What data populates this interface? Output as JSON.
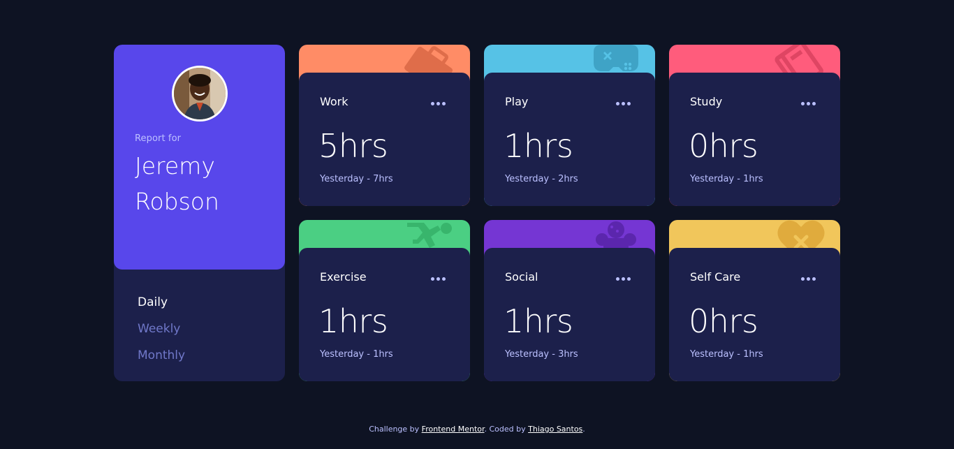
{
  "profile": {
    "report_for": "Report for",
    "first_name": "Jeremy",
    "last_name": "Robson"
  },
  "periods": [
    {
      "label": "Daily",
      "active": true
    },
    {
      "label": "Weekly",
      "active": false
    },
    {
      "label": "Monthly",
      "active": false
    }
  ],
  "activities": [
    {
      "title": "Work",
      "hours": "5hrs",
      "previous": "Yesterday - 7hrs",
      "color": "#ff8c66",
      "icon": "briefcase-icon"
    },
    {
      "title": "Play",
      "hours": "1hrs",
      "previous": "Yesterday - 2hrs",
      "color": "#56c2e6",
      "icon": "gamepad-icon"
    },
    {
      "title": "Study",
      "hours": "0hrs",
      "previous": "Yesterday - 1hrs",
      "color": "#ff5c7c",
      "icon": "book-icon"
    },
    {
      "title": "Exercise",
      "hours": "1hrs",
      "previous": "Yesterday - 1hrs",
      "color": "#4bcf83",
      "icon": "runner-icon"
    },
    {
      "title": "Social",
      "hours": "1hrs",
      "previous": "Yesterday - 3hrs",
      "color": "#7536d3",
      "icon": "social-icon"
    },
    {
      "title": "Self Care",
      "hours": "0hrs",
      "previous": "Yesterday - 1hrs",
      "color": "#f1c65b",
      "icon": "heart-icon"
    }
  ],
  "footer": {
    "prefix": "Challenge by ",
    "link1": "Frontend Mentor",
    "middle": ". Coded by ",
    "link2": "Thiago Santos",
    "suffix": "."
  }
}
